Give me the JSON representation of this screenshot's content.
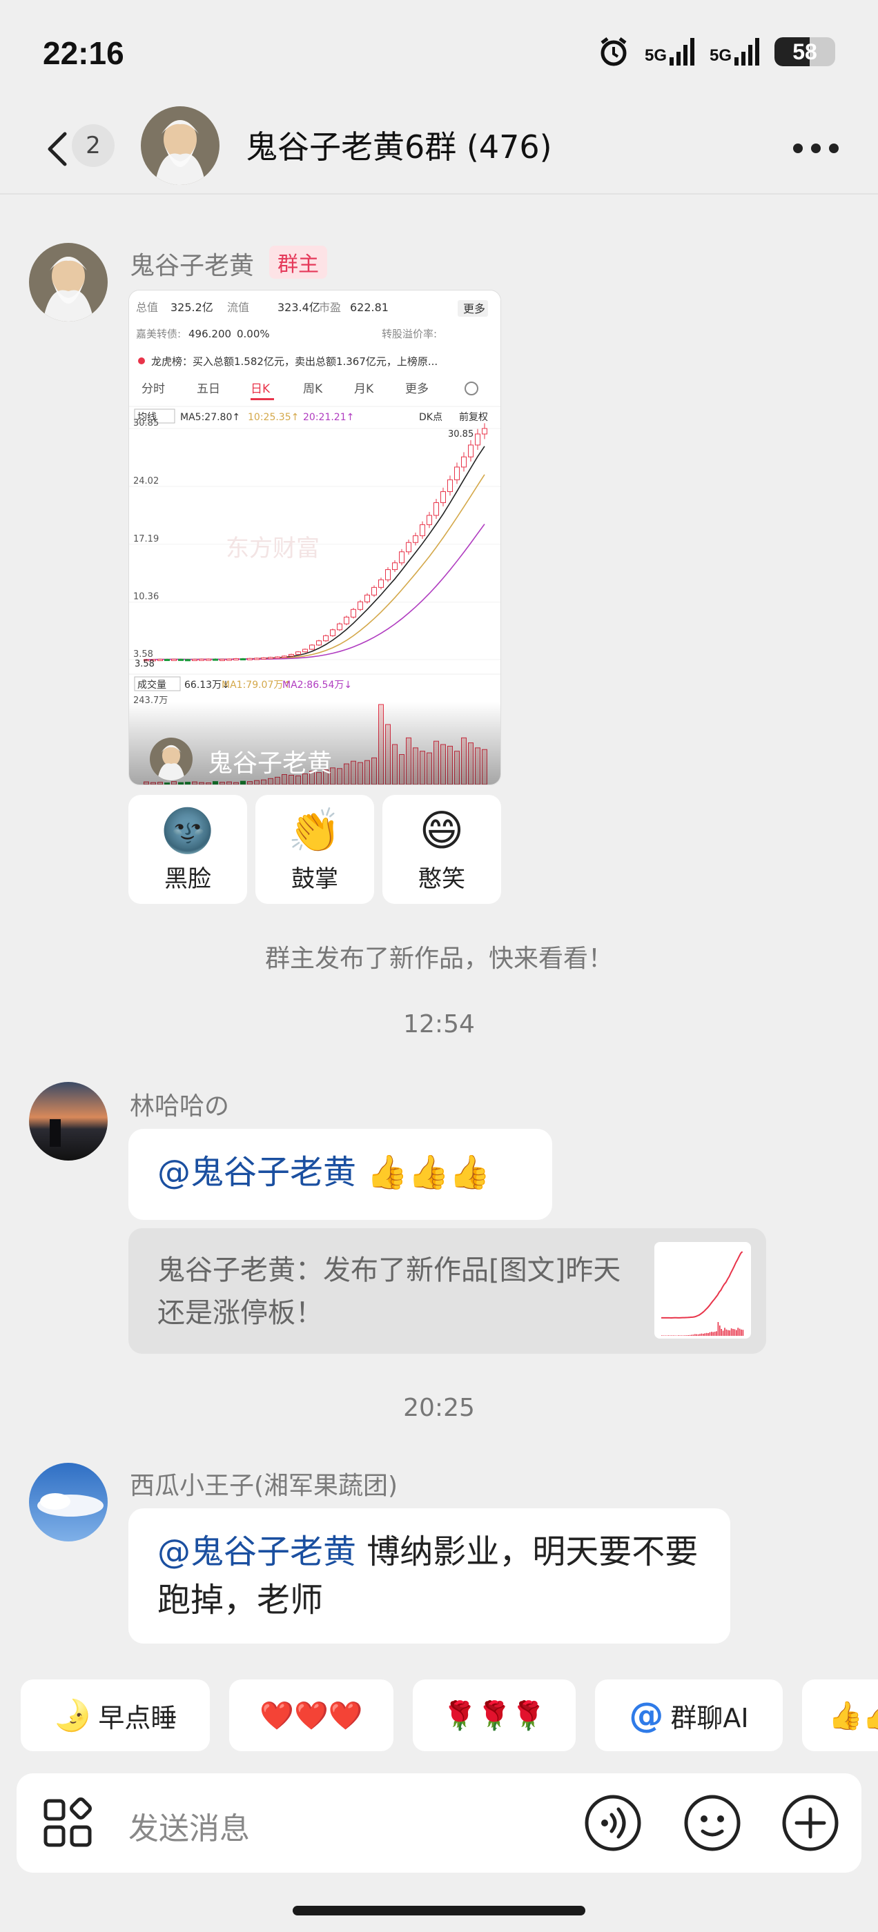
{
  "status_bar": {
    "time": "22:16",
    "signal_1": "5G",
    "signal_2": "5G",
    "battery": "58",
    "battery_level": 0.58
  },
  "header": {
    "unread_count": "2",
    "group_title": "鬼谷子老黄6群 (476)"
  },
  "messages": {
    "m1": {
      "sender": "鬼谷子老黄",
      "role": "群主",
      "card_author": "鬼谷子老黄"
    },
    "reactions": [
      {
        "emoji": "🌚",
        "label": "黑脸"
      },
      {
        "emoji": "👏",
        "label": "鼓掌"
      },
      {
        "emoji": "😄",
        "label": "憨笑"
      }
    ],
    "system_notice": "群主发布了新作品，快来看看！",
    "time_1": "12:54",
    "m2": {
      "sender": "林哈哈の",
      "mention": "@鬼谷子老黄",
      "text": " 👍👍👍",
      "quote": "鬼谷子老黄：发布了新作品[图文]昨天还是涨停板！"
    },
    "time_2": "20:25",
    "m3": {
      "sender": "西瓜小王子(湘军果蔬团)",
      "mention": "@鬼谷子老黄",
      "text": " 博纳影业，明天要不要跑掉，老师"
    }
  },
  "quick_replies": [
    {
      "icon": "moon-icon",
      "label": "早点睡"
    },
    {
      "icon": "hearts-icon",
      "label": "❤️❤️❤️"
    },
    {
      "icon": "roses-icon",
      "label": "🌹🌹🌹"
    },
    {
      "icon": "at-icon",
      "label": "群聊AI"
    },
    {
      "icon": "thumbs-icon",
      "label": "👍👍"
    }
  ],
  "input": {
    "placeholder": "发送消息"
  },
  "stock_card": {
    "row1": [
      "总值",
      "325.2亿",
      "流值",
      "323.4亿",
      "市盈",
      "622.81"
    ],
    "more": "更多",
    "row2_label": "嘉美转债:",
    "row2_value": "496.200",
    "row2_pct": "0.00%",
    "row2_right": "转股溢价率:",
    "dragon": "龙虎榜：买入总额1.582亿元，卖出总额1.367亿元，上榜原...",
    "tabs": [
      "分时",
      "五日",
      "日K",
      "周K",
      "月K",
      "更多"
    ],
    "active_tab": "日K",
    "ma_line": [
      "均线",
      "MA5:27.80↑",
      "10:25.35↑",
      "20:21.21↑"
    ],
    "dk_label": "DK点",
    "fq_label": "前复权",
    "price_ticks": [
      "30.85",
      "24.02",
      "17.19",
      "10.36",
      "3.58"
    ],
    "high_label": "30.85",
    "low_label": "3.58",
    "watermark": "东方财富",
    "volume_labels": [
      "成交量",
      "66.13万↓",
      "MA1:79.07万↑",
      "MA2:86.54万↓"
    ],
    "volume_max": "243.7万",
    "candles": [
      3.6,
      3.6,
      3.62,
      3.61,
      3.63,
      3.6,
      3.59,
      3.62,
      3.64,
      3.65,
      3.6,
      3.62,
      3.66,
      3.7,
      3.68,
      3.72,
      3.75,
      3.8,
      3.85,
      3.9,
      4.0,
      4.2,
      4.5,
      4.8,
      5.3,
      5.8,
      6.4,
      7.1,
      7.8,
      8.6,
      9.5,
      10.4,
      11.2,
      12.1,
      13.0,
      14.2,
      15.0,
      16.3,
      17.4,
      18.2,
      19.5,
      20.6,
      22.1,
      23.4,
      24.8,
      26.3,
      27.5,
      28.9,
      30.2,
      30.85
    ],
    "volumes": [
      8,
      6,
      7,
      5,
      9,
      6,
      7,
      8,
      6,
      5,
      9,
      7,
      8,
      6,
      10,
      9,
      12,
      14,
      18,
      22,
      30,
      28,
      26,
      32,
      40,
      36,
      44,
      50,
      48,
      62,
      70,
      66,
      72,
      80,
      240,
      180,
      120,
      90,
      140,
      110,
      100,
      95,
      130,
      120,
      115,
      100,
      140,
      125,
      110,
      105
    ]
  },
  "colors": {
    "mention": "#1a4fa0",
    "role_tag_bg": "#fde3e6",
    "role_tag_fg": "#e5395a",
    "bg": "#efefef"
  }
}
